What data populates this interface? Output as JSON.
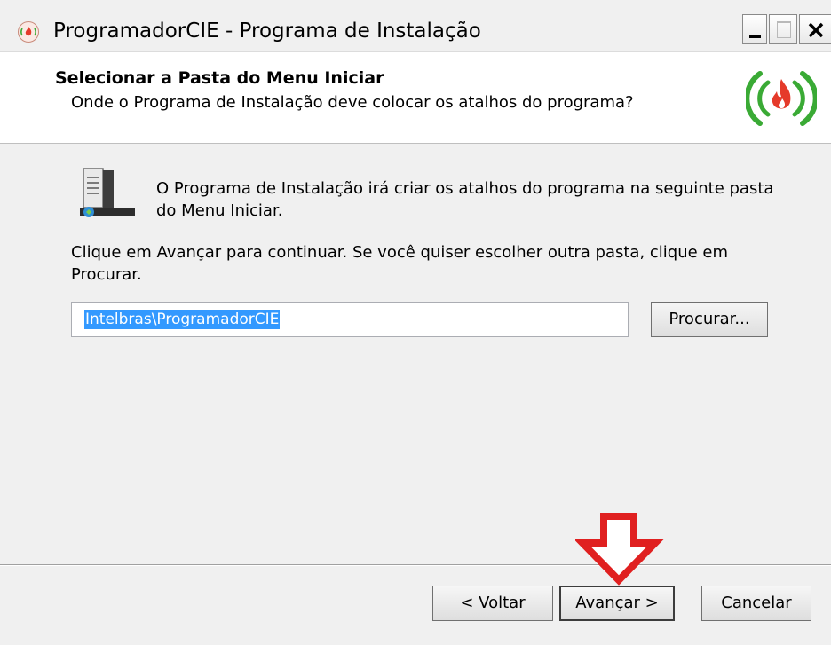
{
  "window": {
    "title": "ProgramadorCIE - Programa de Instalação"
  },
  "header": {
    "title": "Selecionar a Pasta do Menu Iniciar",
    "subtitle": "Onde o Programa de Instalação deve colocar os atalhos do programa?",
    "logo_icon": "brand-flame-signal-icon"
  },
  "body": {
    "info_text": "O Programa de Instalação irá criar os atalhos do programa na seguinte pasta do Menu Iniciar.",
    "click_text": "Clique em Avançar para continuar. Se você quiser escolher outra pasta, clique em Procurar.",
    "folder_path": "Intelbras\\ProgramadorCIE",
    "browse_label": "Procurar..."
  },
  "footer": {
    "back_label": "< Voltar",
    "next_label": "Avançar >",
    "cancel_label": "Cancelar"
  },
  "colors": {
    "selection": "#3399ff",
    "annotation_arrow": "#e02020",
    "logo_green": "#3aaa35",
    "logo_red": "#e53a2a"
  }
}
